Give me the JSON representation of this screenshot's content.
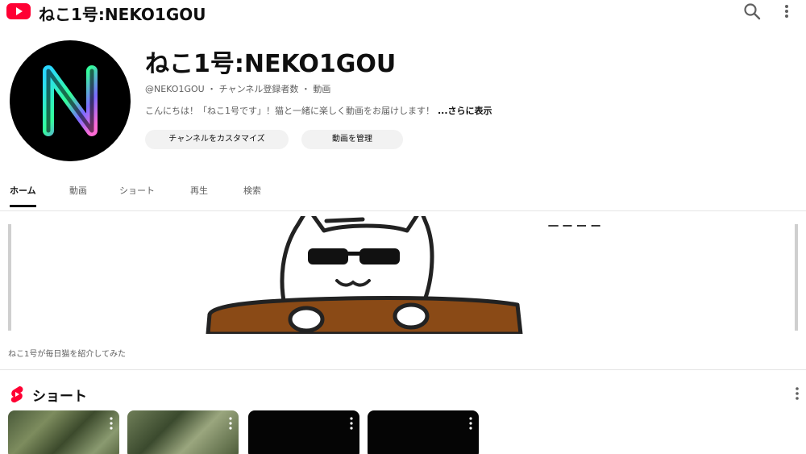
{
  "topbar": {
    "title": "ねこ1号:NEKO1GOU",
    "logo_icon": "youtube-logo-icon",
    "search_icon": "search-icon",
    "more_icon": "more-vertical-icon"
  },
  "channel": {
    "name": "ねこ1号:NEKO1GOU",
    "meta": "@NEKO1GOU ・ チャンネル登録者数 ・ 動画",
    "description": "こんにちは！「ねこ1号です」！猫と一緒に楽しく動画をお届けします！",
    "description_more": "...さらに表示",
    "avatar_letter": "N"
  },
  "buttons": {
    "customize": "チャンネルをカスタマイズ",
    "manage": "動画を管理"
  },
  "tabs": [
    {
      "label": "ホーム",
      "active": true
    },
    {
      "label": "動画",
      "active": false
    },
    {
      "label": "ショート",
      "active": false
    },
    {
      "label": "再生",
      "active": false
    },
    {
      "label": "検索",
      "active": false
    }
  ],
  "featured": {
    "overlay_text": "一 ー ー ー",
    "caption": "ねこ1号が毎日猫を紹介してみた"
  },
  "shorts": {
    "title": "ショート",
    "icon": "shorts-icon",
    "more_icon": "more-vertical-icon",
    "items": [
      {
        "kind": "forest-thumbnail"
      },
      {
        "kind": "forest-thumbnail"
      },
      {
        "kind": "dark-thumbnail"
      },
      {
        "kind": "dark-thumbnail"
      }
    ]
  },
  "colors": {
    "brand": "#ff0033",
    "text": "#0f0f0f",
    "secondary": "#606060",
    "chip": "#f2f2f2",
    "desk": "#8a4a16"
  }
}
